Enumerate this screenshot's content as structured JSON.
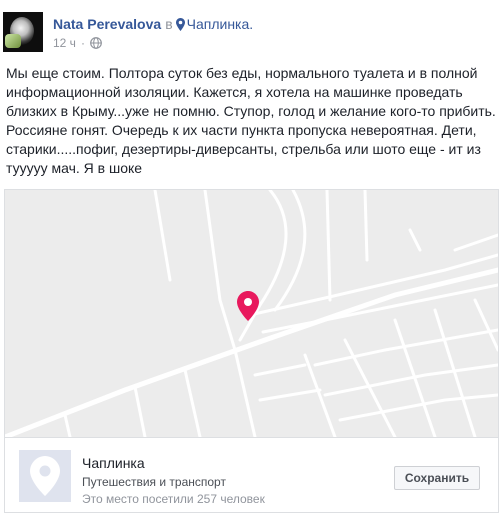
{
  "post": {
    "author": "Nata Perevalova",
    "in_word": "в",
    "place_link": "Чаплинка.",
    "timestamp": "12 ч",
    "dot": "·",
    "text": "Мы еще стоим. Полтора суток без еды, нормального туалета и в полной информационной изоляции. Кажется, я хотела на машинке проведать близких в Крыму...уже не помню. Ступор, голод и желание кого-то прибить. Россияне гонят. Очередь к их части пункта пропуска невероятная. Дети, старики.....пофиг, дезертиры-диверсанты, стрельба или шото еще - ит из тууууу мач. Я в шоке"
  },
  "place_card": {
    "name": "Чаплинка",
    "category": "Путешествия и транспорт",
    "visits": "Это место посетили 257 человек",
    "save_label": "Сохранить"
  },
  "colors": {
    "link": "#365899",
    "map_pin": "#e8195d",
    "map_bg": "#ececec",
    "map_road": "#ffffff"
  },
  "icons": [
    "globe-icon",
    "location-pin-icon",
    "map-pin-icon",
    "place-pin-icon"
  ]
}
